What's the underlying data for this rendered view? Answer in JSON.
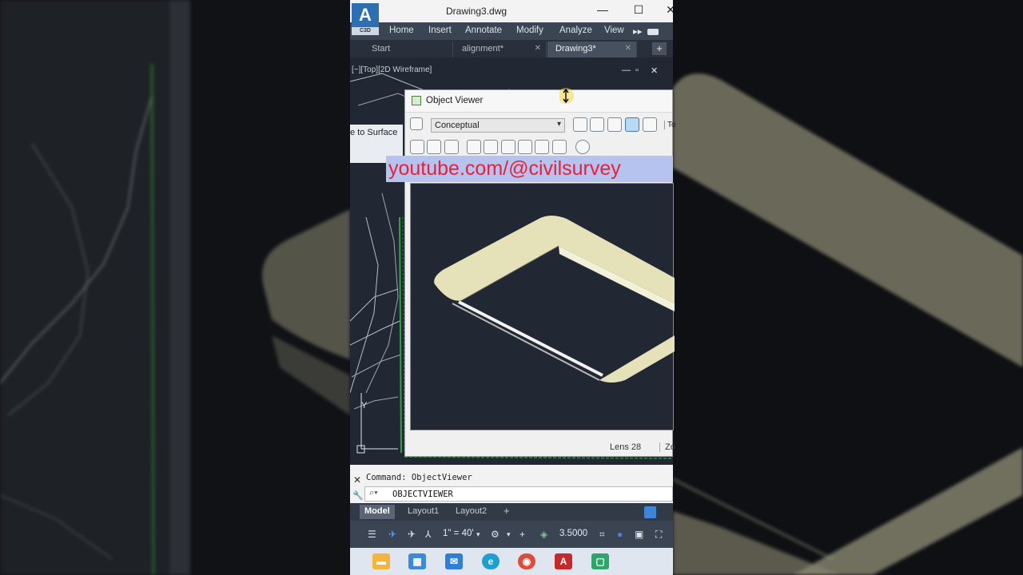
{
  "app": {
    "logo_letter": "A",
    "logo_sub": "C3D",
    "document_title": "Drawing3.dwg",
    "window_controls": [
      "—",
      "☐",
      "✕"
    ]
  },
  "ribbon_tabs": [
    "Home",
    "Insert",
    "Annotate",
    "Modify",
    "Analyze",
    "View"
  ],
  "ribbon_overflow": "▸▸",
  "file_tabs": [
    {
      "label": "Start",
      "closable": false
    },
    {
      "label": "alignment*",
      "closable": true
    },
    {
      "label": "Drawing3*",
      "closable": true,
      "active": true
    }
  ],
  "file_tab_add": "+",
  "viewport": {
    "label": "[−][Top][2D Wireframe]",
    "controls": [
      "—",
      "▫",
      "✕"
    ],
    "side_panel_text": "e to Surface",
    "ucs_y": "Y"
  },
  "object_viewer": {
    "title": "Object Viewer",
    "visual_style": "Conceptual",
    "toolbar_more": "To",
    "lens_label": "Lens 28",
    "zoom_label": "Zo"
  },
  "banner_text": "youtube.com/@civilsurvey",
  "command": {
    "history": "Command: ObjectViewer",
    "input": "OBJECTVIEWER",
    "close_glyph": "✕",
    "wrench_glyph": "🔧"
  },
  "layout_tabs": [
    "Model",
    "Layout1",
    "Layout2"
  ],
  "layout_tab_add": "+",
  "status": {
    "scale": "1\" = 40'",
    "value": "3.5000"
  },
  "taskbar_icons": [
    "file-explorer-icon",
    "store-icon",
    "mail-icon",
    "edge-icon",
    "chrome-icon",
    "autocad-icon",
    "civil3d-icon"
  ],
  "colors": {
    "banner_bg": "#b6c3ef",
    "banner_text": "#e8213a",
    "canvas_bg": "#212834",
    "solid_face": "#e5e2ba",
    "taskbar": "#dfe6ef"
  }
}
